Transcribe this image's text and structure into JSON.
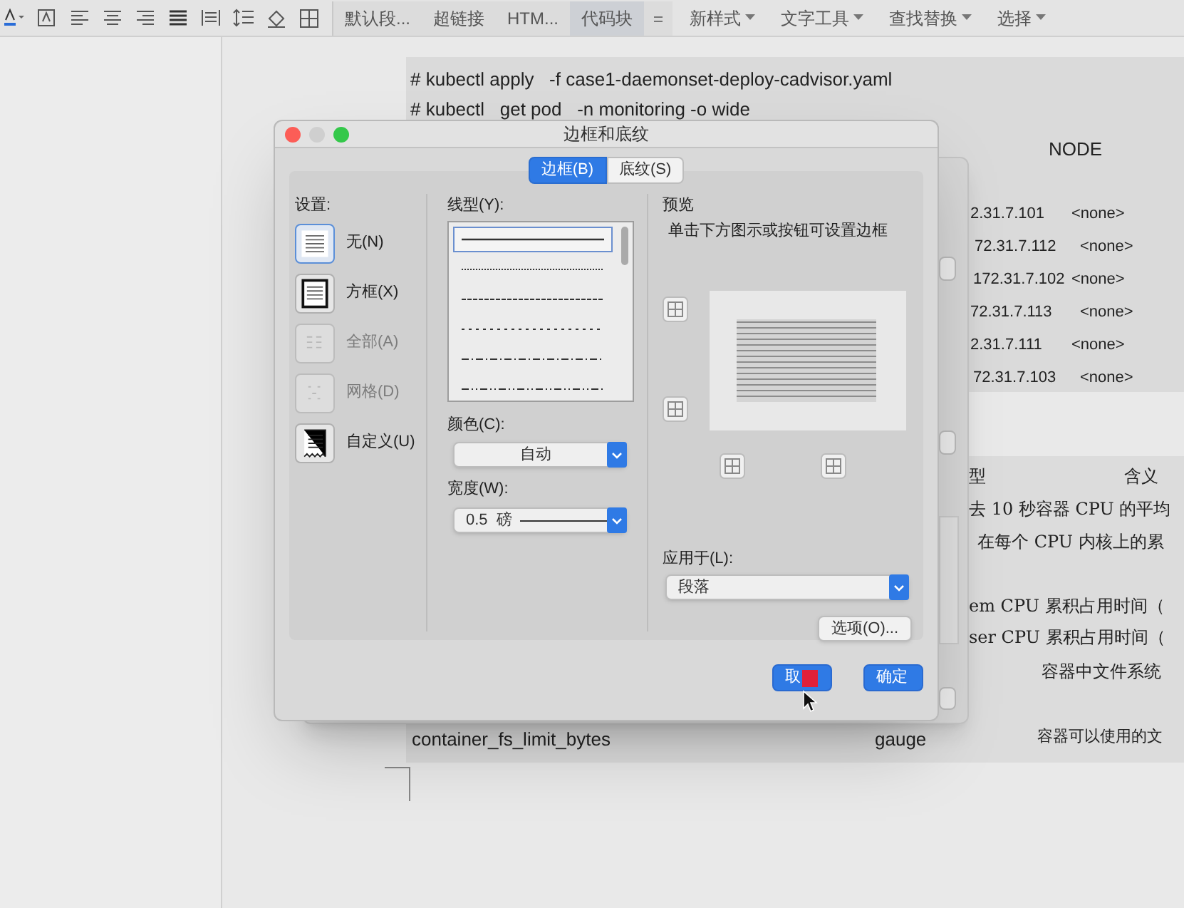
{
  "toolbar": {
    "gallery": [
      {
        "label": "默认段...",
        "selected": false
      },
      {
        "label": "超链接",
        "selected": false
      },
      {
        "label": "HTM...",
        "selected": false
      },
      {
        "label": "代码块",
        "selected": true
      }
    ],
    "menus": [
      "新样式",
      "文字工具",
      "查找替换",
      "选择"
    ]
  },
  "document": {
    "commands": [
      "# kubectl apply   -f case1-daemonset-deploy-cadvisor.yaml",
      "# kubectl   get pod   -n monitoring -o wide"
    ],
    "node_header": "NODE",
    "node_rows": [
      {
        "ip": "2.31.7.101",
        "node": "<none>"
      },
      {
        "ip": "72.31.7.112",
        "node": "<none>"
      },
      {
        "ip": "172.31.7.102",
        "node": "<none>"
      },
      {
        "ip": "72.31.7.113",
        "node": "<none>"
      },
      {
        "ip": "2.31.7.111",
        "node": "<none>"
      },
      {
        "ip": "72.31.7.103",
        "node": "<none>"
      }
    ],
    "table_header": [
      "型",
      "含义"
    ],
    "table_lines": [
      "去 10 秒容器 CPU 的平均",
      "在每个 CPU 内核上的累",
      "em CPU 累积占用时间（",
      "ser CPU 累积占用时间（",
      "容器中文件系统"
    ],
    "last_row": {
      "name": "container_fs_limit_bytes",
      "type": "gauge",
      "meaning": "容器可以使用的文"
    }
  },
  "dialog": {
    "title": "边框和底纹",
    "tabs": [
      {
        "label": "边框(B)",
        "selected": true
      },
      {
        "label": "底纹(S)",
        "selected": false
      }
    ],
    "settings": {
      "label": "设置:",
      "items": [
        {
          "label": "无(N)",
          "kind": "none",
          "selected": true,
          "disabled": false
        },
        {
          "label": "方框(X)",
          "kind": "box",
          "selected": false,
          "disabled": false
        },
        {
          "label": "全部(A)",
          "kind": "all",
          "selected": false,
          "disabled": true
        },
        {
          "label": "网格(D)",
          "kind": "grid",
          "selected": false,
          "disabled": true
        },
        {
          "label": "自定义(U)",
          "kind": "custom",
          "selected": false,
          "disabled": false
        }
      ]
    },
    "line_style": {
      "label": "线型(Y):",
      "options": [
        {
          "kind": "solid",
          "selected": true
        },
        {
          "kind": "dotted",
          "selected": false
        },
        {
          "kind": "dashed",
          "selected": false
        },
        {
          "kind": "sparse",
          "selected": false
        },
        {
          "kind": "dashdot",
          "selected": false
        },
        {
          "kind": "dashdotdot",
          "selected": false
        }
      ]
    },
    "color": {
      "label": "颜色(C):",
      "value": "自动"
    },
    "width": {
      "label": "宽度(W):",
      "value": "0.5  磅"
    },
    "preview": {
      "label": "预览",
      "hint": "单击下方图示或按钮可设置边框"
    },
    "apply_to": {
      "label": "应用于(L):",
      "value": "段落"
    },
    "options_button": "选项(O)...",
    "buttons": [
      {
        "label": "取",
        "kind": "cancel"
      },
      {
        "label": "确定",
        "kind": "ok"
      }
    ]
  }
}
